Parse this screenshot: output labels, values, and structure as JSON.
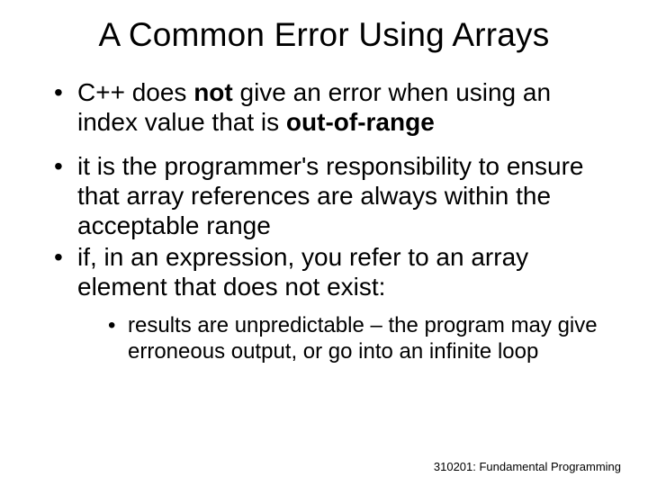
{
  "title": "A Common Error Using Arrays",
  "bullets": {
    "b1_pre": "C++ does ",
    "b1_not": "not",
    "b1_mid": " give an error when using an index value that is ",
    "b1_oor": "out-of-range",
    "b2": "it is the programmer's responsibility to ensure that array references are always within the acceptable range",
    "b3": "if, in an expression, you refer to an array element that does not exist:",
    "sub1": "results are unpredictable – the program may give erroneous output, or go into an infinite loop"
  },
  "footer": "310201: Fundamental Programming"
}
